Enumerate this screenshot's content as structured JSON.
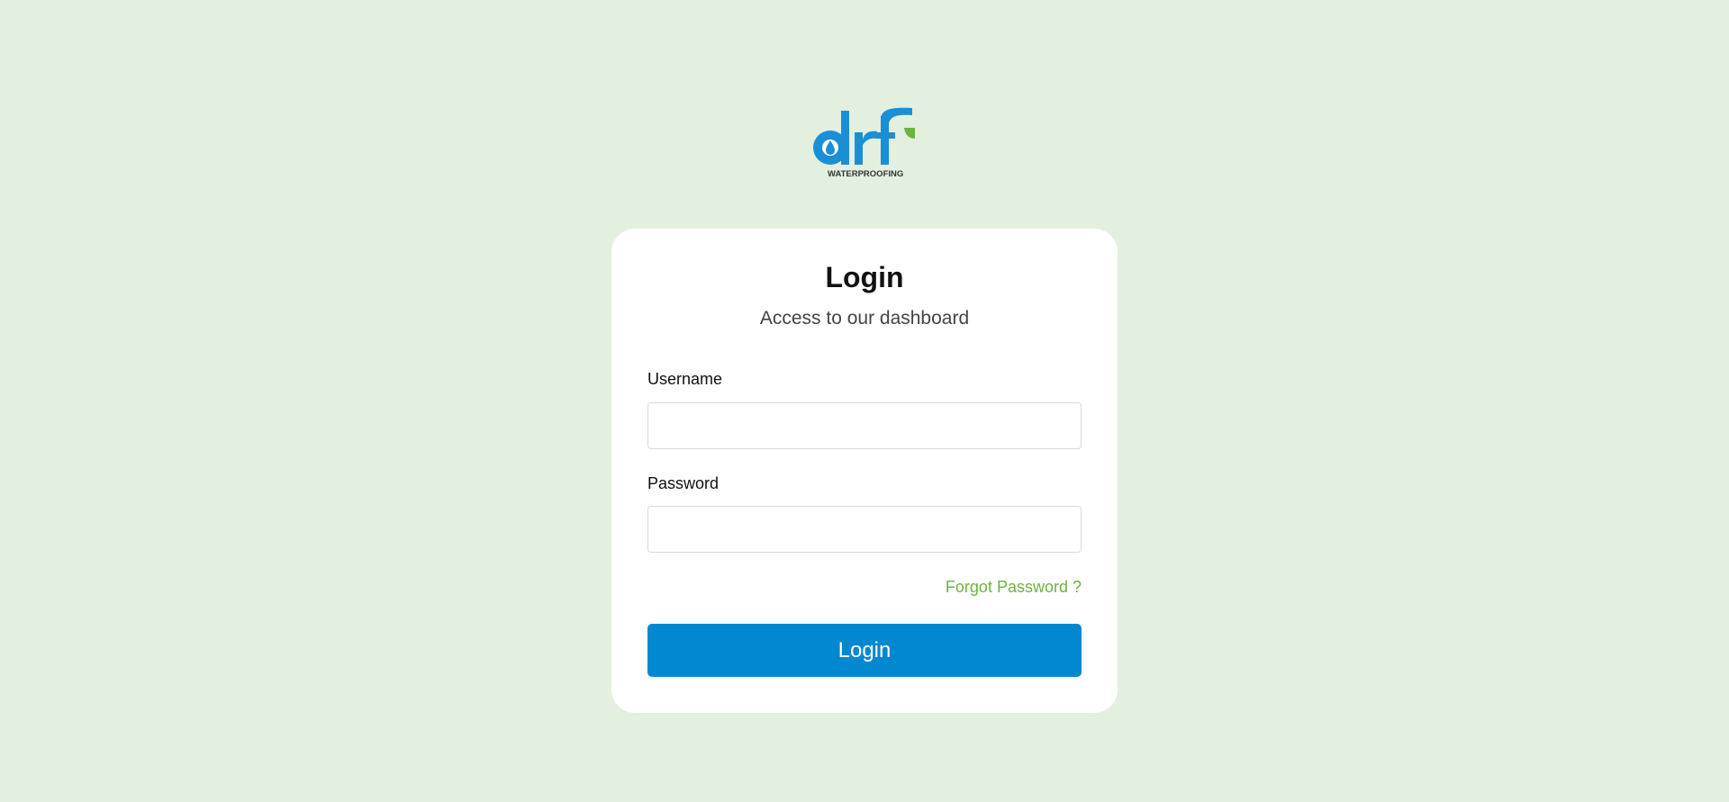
{
  "brand": {
    "logo_letters": "drf",
    "logo_tagline": "WATERPROOFING",
    "colors": {
      "primary_blue": "#0288d1",
      "accent_green": "#6cb33f",
      "background": "#e3efdf"
    }
  },
  "login_card": {
    "title": "Login",
    "subtitle": "Access to our dashboard",
    "username_label": "Username",
    "username_value": "",
    "password_label": "Password",
    "password_value": "",
    "forgot_password_link": "Forgot Password ?",
    "submit_label": "Login"
  }
}
